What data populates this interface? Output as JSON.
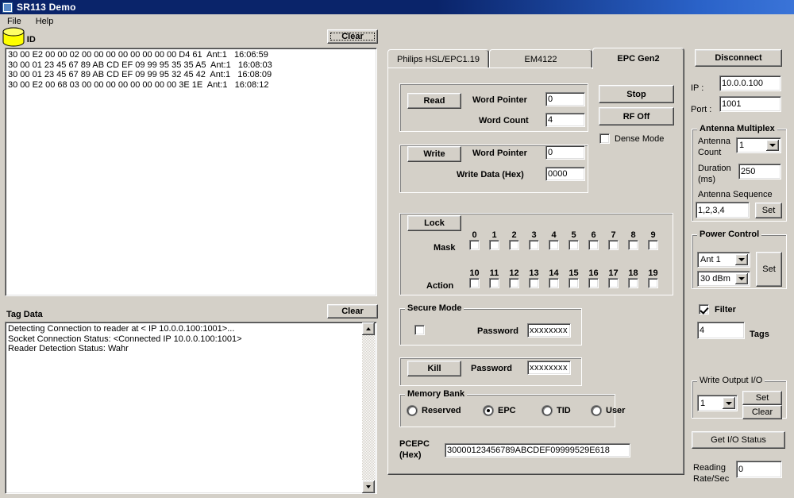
{
  "window": {
    "title": "SR113 Demo",
    "icon": "app-icon"
  },
  "menu": {
    "items": [
      {
        "label": "File"
      },
      {
        "label": "Help"
      }
    ]
  },
  "tag_id_panel": {
    "label": "Tag ID",
    "clear_label": "Clear",
    "rows": [
      {
        "epc": "30 00 E2 00 00 02 00 00 00 00 00 00 00 00 D4 61",
        "ant": "Ant:1",
        "time": "16:06:59"
      },
      {
        "epc": "30 00 01 23 45 67 89 AB CD EF 09 99 95 35 35 A5",
        "ant": "Ant:1",
        "time": "16:08:03"
      },
      {
        "epc": "30 00 01 23 45 67 89 AB CD EF 09 99 95 32 45 42",
        "ant": "Ant:1",
        "time": "16:08:09"
      },
      {
        "epc": "30 00 E2 00 68 03 00 00 00 00 00 00 00 00 3E 1E",
        "ant": "Ant:1",
        "time": "16:08:12"
      }
    ]
  },
  "tag_data_panel": {
    "label": "Tag Data",
    "clear_label": "Clear",
    "lines": [
      "Detecting Connection to reader at < IP 10.0.0.100:1001>...",
      "Socket Connection Status: <Connected IP 10.0.0.100:1001>",
      "Reader Detection Status: Wahr"
    ]
  },
  "tabs": [
    {
      "label": "Philips HSL/EPC1.19",
      "active": false
    },
    {
      "label": "EM4122",
      "active": false
    },
    {
      "label": "EPC Gen2",
      "active": true
    }
  ],
  "epc_gen2": {
    "read": {
      "button": "Read",
      "word_pointer_label": "Word Pointer",
      "word_pointer_value": "0",
      "word_count_label": "Word Count",
      "word_count_value": "4"
    },
    "write": {
      "button": "Write",
      "word_pointer_label": "Word Pointer",
      "word_pointer_value": "0",
      "write_data_label": "Write Data (Hex)",
      "write_data_value": "0000"
    },
    "stop_label": "Stop",
    "rf_off_label": "RF Off",
    "dense_mode_label": "Dense Mode",
    "dense_mode_checked": false,
    "lock": {
      "button": "Lock",
      "mask_label": "Mask",
      "action_label": "Action",
      "mask_numbers": [
        "0",
        "1",
        "2",
        "3",
        "4",
        "5",
        "6",
        "7",
        "8",
        "9"
      ],
      "action_numbers": [
        "10",
        "11",
        "12",
        "13",
        "14",
        "15",
        "16",
        "17",
        "18",
        "19"
      ]
    },
    "secure_mode": {
      "title": "Secure Mode",
      "checked": false,
      "password_label": "Password",
      "password_value": "xxxxxxxx"
    },
    "kill": {
      "button": "Kill",
      "password_label": "Password",
      "password_value": "xxxxxxxx"
    },
    "memory_bank": {
      "title": "Memory Bank",
      "options": [
        {
          "label": "Reserved",
          "selected": false
        },
        {
          "label": "EPC",
          "selected": true
        },
        {
          "label": "TID",
          "selected": false
        },
        {
          "label": "User",
          "selected": false
        }
      ]
    },
    "pcepc": {
      "label_line1": "PCEPC",
      "label_line2": "(Hex)",
      "value": "30000123456789ABCDEF09999529E618"
    }
  },
  "sidebar": {
    "disconnect_label": "Disconnect",
    "ip_label": "IP :",
    "ip_value": "10.0.0.100",
    "port_label": "Port :",
    "port_value": "1001",
    "antenna_multiplex": {
      "title": "Antenna Multiplex",
      "antenna_count_label_line1": "Antenna",
      "antenna_count_label_line2": "Count",
      "antenna_count_value": "1",
      "duration_label_line1": "Duration",
      "duration_label_line2": "(ms)",
      "duration_value": "250",
      "antenna_sequence_label": "Antenna Sequence",
      "antenna_sequence_value": "1,2,3,4",
      "set_label": "Set"
    },
    "power_control": {
      "title": "Power Control",
      "antenna_value": "Ant 1",
      "power_value": "30 dBm",
      "set_label": "Set"
    },
    "filter": {
      "label": "Filter",
      "checked": true,
      "value": "4",
      "tags_label": "Tags"
    },
    "write_output_io": {
      "title": "Write Output I/O",
      "value": "1",
      "set_label": "Set",
      "clear_label": "Clear"
    },
    "get_io_status_label": "Get I/O Status",
    "reading_rate": {
      "label_line1": "Reading",
      "label_line2": "Rate/Sec",
      "value": "0"
    }
  },
  "colors": {
    "face": "#d4d0c8",
    "title_bar": "#0a246a",
    "highlight_icon": "#ffff00"
  }
}
